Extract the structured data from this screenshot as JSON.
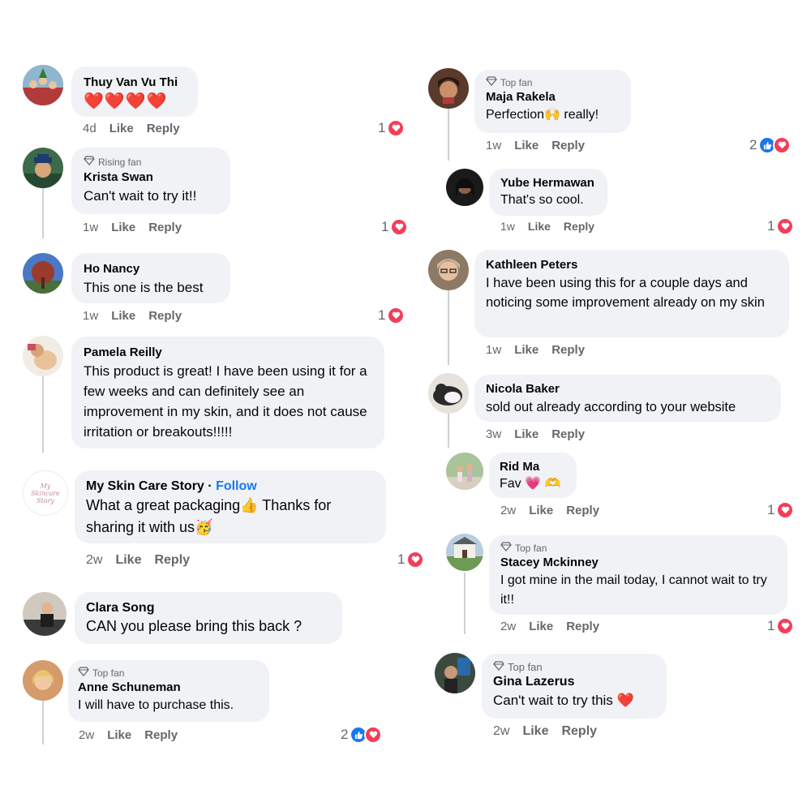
{
  "left": [
    {
      "name": "Thuy Van Vu Thi",
      "badge": "",
      "text": "❤️❤️❤️❤️",
      "time": "4d",
      "like": "Like",
      "reply": "Reply",
      "react": "1",
      "react_type": "love"
    },
    {
      "name": "Krista Swan",
      "badge": "Rising fan",
      "text": "Can't wait to try it!!",
      "time": "1w",
      "like": "Like",
      "reply": "Reply",
      "react": "1",
      "react_type": "love"
    },
    {
      "name": "Ho Nancy",
      "badge": "",
      "text": "This one is the best",
      "time": "1w",
      "like": "Like",
      "reply": "Reply",
      "react": "1",
      "react_type": "love"
    },
    {
      "name": "Pamela Reilly",
      "badge": "",
      "text": "This product is great! I have been using it for a few weeks and can definitely see an improvement in my skin, and it does not cause irritation or breakouts!!!!!",
      "time": "",
      "like": "",
      "reply": "",
      "react": "",
      "react_type": ""
    },
    {
      "name": "My Skin Care Story",
      "follow": "Follow",
      "separator": "·",
      "badge": "",
      "text": "What a  great packaging👍 Thanks for sharing it with us🥳",
      "time": "2w",
      "like": "Like",
      "reply": "Reply",
      "react": "1",
      "react_type": "love",
      "avatar_text": "My Skincare Story"
    },
    {
      "name": "Clara Song",
      "badge": "",
      "text": "CAN you please bring this back ?",
      "time": "",
      "like": "",
      "reply": "",
      "react": "",
      "react_type": ""
    },
    {
      "name": "Anne Schuneman",
      "badge": "Top fan",
      "text": "I will have to purchase this.",
      "time": "2w",
      "like": "Like",
      "reply": "Reply",
      "react": "2",
      "react_type": "likelove"
    }
  ],
  "right": [
    {
      "name": "Maja Rakela",
      "badge": "Top fan",
      "text": "Perfection🙌 really!",
      "time": "1w",
      "like": "Like",
      "reply": "Reply",
      "react": "2",
      "react_type": "likelove"
    },
    {
      "name": "Yube Hermawan",
      "badge": "",
      "text": "That's so cool.",
      "time": "1w",
      "like": "Like",
      "reply": "Reply",
      "react": "1",
      "react_type": "love"
    },
    {
      "name": "Kathleen Peters",
      "badge": "",
      "text": "I have been using this for a couple days and noticing some improvement already on my skin",
      "time": "1w",
      "like": "Like",
      "reply": "Reply",
      "react": "",
      "react_type": ""
    },
    {
      "name": "Nicola Baker",
      "badge": "",
      "text": "sold out already according to your website",
      "time": "3w",
      "like": "Like",
      "reply": "Reply",
      "react": "",
      "react_type": ""
    },
    {
      "name": "Rid Ma",
      "badge": "",
      "text": "Fav 💗 🫶",
      "time": "2w",
      "like": "Like",
      "reply": "Reply",
      "react": "1",
      "react_type": "love"
    },
    {
      "name": "Stacey Mckinney",
      "badge": "Top fan",
      "text": "I got mine in the mail today, I cannot wait to try it!!",
      "time": "2w",
      "like": "Like",
      "reply": "Reply",
      "react": "1",
      "react_type": "love"
    },
    {
      "name": "Gina Lazerus",
      "badge": "Top fan",
      "text": "Can't wait to try this ❤️",
      "time": "2w",
      "like": "Like",
      "reply": "Reply",
      "react": "",
      "react_type": ""
    }
  ],
  "colors": {
    "bubble": "#f0f2f5",
    "meta": "#65676b",
    "follow": "#1877f2",
    "love": "#f33e58",
    "like": "#1877f2",
    "thread": "#ced0d4"
  }
}
